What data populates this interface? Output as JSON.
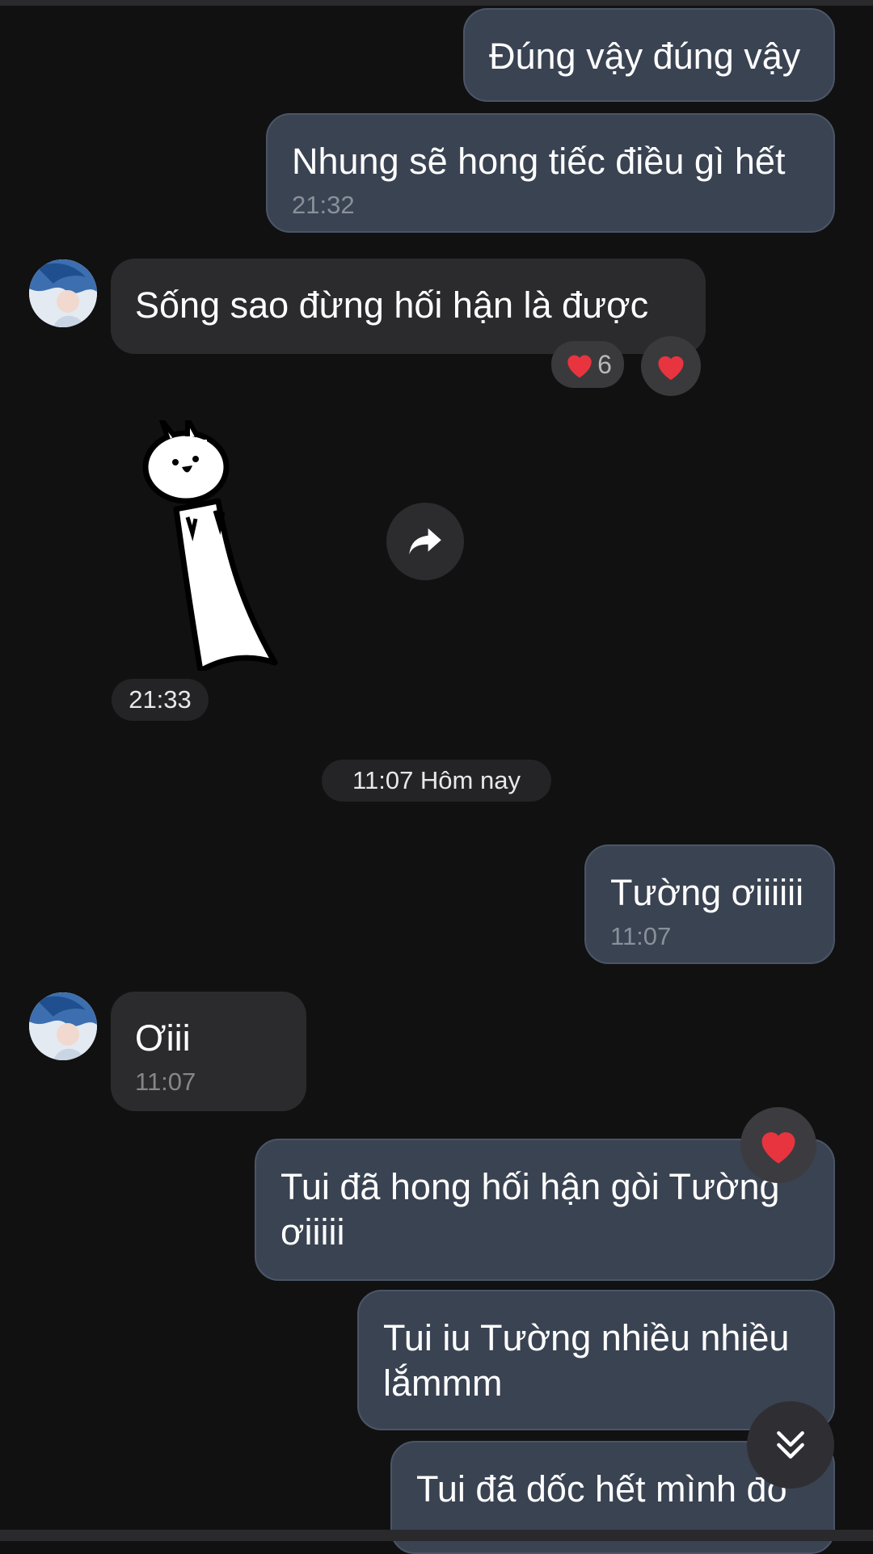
{
  "messages": {
    "m1": {
      "text": "Đúng vậy đúng vậy"
    },
    "m2": {
      "text": "Nhung sẽ hong tiếc điều gì hết",
      "time": "21:32"
    },
    "m3": {
      "text": "Sống sao đừng hối hận là được",
      "reaction_count": "6"
    },
    "sticker": {
      "time": "21:33"
    },
    "m4": {
      "text": "Tường ơiiiiii",
      "time": "11:07"
    },
    "m5": {
      "text": "Ơiii",
      "time": "11:07"
    },
    "m6": {
      "text": "Tui đã hong hối hận gòi Tường ơiiiii"
    },
    "m7": {
      "text": "Tui iu Tường nhiều nhiều lắmmm"
    },
    "m8": {
      "text": "Tui đã dốc hết mình đó"
    }
  },
  "divider": {
    "label": "11:07 Hôm nay"
  },
  "colors": {
    "background": "#111112",
    "sent_bubble": "#3a4352",
    "received_bubble": "#2b2b2d",
    "heart": "#e8343f"
  },
  "icons": {
    "reaction": "heart-icon",
    "share": "share-arrow-icon",
    "scroll_down": "double-chevron-down-icon"
  }
}
